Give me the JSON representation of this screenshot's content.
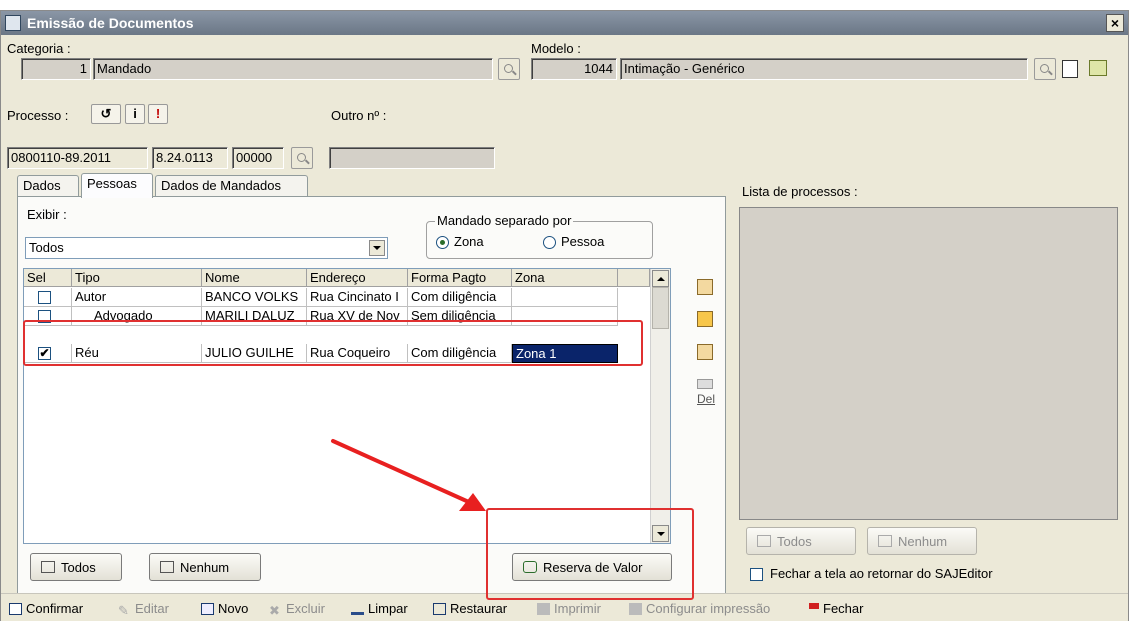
{
  "window": {
    "title": "Emissão de Documentos",
    "close_label": "×"
  },
  "categoria": {
    "label": "Categoria :",
    "code": "1",
    "name": "Mandado"
  },
  "modelo": {
    "label": "Modelo :",
    "code": "1044",
    "name": "Intimação - Genérico"
  },
  "processo": {
    "label": "Processo :",
    "part1": "0800110-89.2011",
    "part2": "8.24.0113",
    "part3": "00000",
    "info_icon": "i",
    "alert_icon": "!"
  },
  "outro": {
    "label": "Outro nº :",
    "value": ""
  },
  "tabs": [
    {
      "label": "Dados"
    },
    {
      "label": "Pessoas"
    },
    {
      "label": "Dados de Mandados"
    }
  ],
  "exibir": {
    "label": "Exibir :",
    "value": "Todos"
  },
  "mandado_separado": {
    "legend": "Mandado separado por",
    "option_zona": "Zona",
    "option_pessoa": "Pessoa",
    "selected": "Zona"
  },
  "grid": {
    "columns": [
      "Sel",
      "Tipo",
      "Nome",
      "Endereço",
      "Forma Pagto",
      "Zona"
    ],
    "rows": [
      {
        "sel": "",
        "tipo": "Autor",
        "nome": "BANCO VOLKS",
        "endereco": "Rua Cincinato I",
        "forma": "Com diligência",
        "zona": ""
      },
      {
        "sel": "",
        "tipo": "Advogado",
        "nome": "MARILI DALUZ",
        "endereco": "Rua XV de Nov",
        "forma": "Sem diligência",
        "zona": ""
      },
      {
        "sel": "✔",
        "tipo": "Réu",
        "nome": "JULIO GUILHE",
        "endereco": "Rua Coqueiro",
        "forma": "Com diligência",
        "zona": "Zona 1"
      }
    ]
  },
  "side_icons": {
    "del_label": "Del"
  },
  "buttons": {
    "todos": "Todos",
    "nenhum": "Nenhum",
    "reserva": "Reserva de Valor"
  },
  "lista": {
    "label": "Lista de processos :",
    "todos": "Todos",
    "nenhum": "Nenhum",
    "fechar_label": "Fechar a tela ao retornar do SAJEditor"
  },
  "toolbar": {
    "confirmar": "Confirmar",
    "editar": "Editar",
    "novo": "Novo",
    "excluir": "Excluir",
    "limpar": "Limpar",
    "restaurar": "Restaurar",
    "imprimir": "Imprimir",
    "configurar": "Configurar impressão",
    "fechar": "Fechar"
  },
  "colors": {
    "selection": "#0a246a",
    "annotation": "#e03030",
    "titlebar": "#7a8596"
  }
}
